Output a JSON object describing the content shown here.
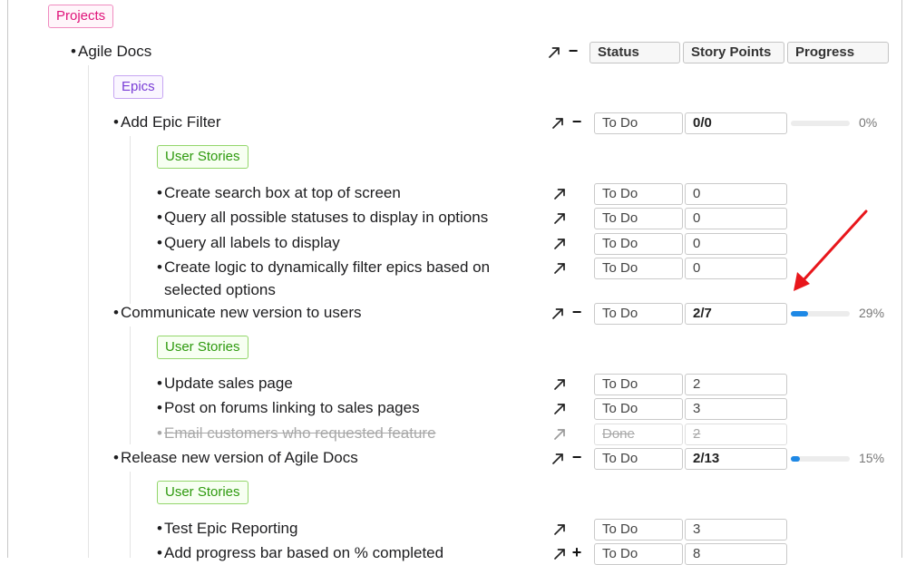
{
  "tags": {
    "projects": "Projects",
    "epics": "Epics",
    "user_stories": "User Stories"
  },
  "columns": {
    "status": "Status",
    "story_points": "Story Points",
    "progress": "Progress"
  },
  "icons": {
    "open": "arrow-up-left-icon",
    "collapse": "minus-icon",
    "expand": "plus-icon"
  },
  "colors": {
    "progress_fill": "#1e88e5",
    "projects_tag": "#e0137a",
    "epics_tag": "#7a3dd6",
    "stories_tag": "#2e9a0e",
    "annotation_arrow": "#e8161b"
  },
  "project": {
    "bullet": "•",
    "title": "Agile Docs",
    "control": "−"
  },
  "epics": [
    {
      "bullet": "•",
      "title": "Add Epic Filter",
      "control": "−",
      "status": "To Do",
      "points": "0/0",
      "progress": 0,
      "progress_label": "0%",
      "stories": [
        {
          "bullet": "•",
          "title": "Create search box at top of screen",
          "status": "To Do",
          "points": "0"
        },
        {
          "bullet": "•",
          "title": "Query all possible statuses to display in options",
          "status": "To Do",
          "points": "0"
        },
        {
          "bullet": "•",
          "title": "Query all labels to display",
          "status": "To Do",
          "points": "0"
        },
        {
          "bullet": "•",
          "title": "Create logic to dynamically filter epics based on",
          "title_cont": "selected options",
          "status": "To Do",
          "points": "0"
        }
      ]
    },
    {
      "bullet": "•",
      "title": "Communicate new version to users",
      "control": "−",
      "status": "To Do",
      "points": "2/7",
      "progress": 0.29,
      "progress_label": "29%",
      "stories": [
        {
          "bullet": "•",
          "title": "Update sales page",
          "status": "To Do",
          "points": "2"
        },
        {
          "bullet": "•",
          "title": "Post on forums linking to sales pages",
          "status": "To Do",
          "points": "3"
        },
        {
          "bullet": "•",
          "title": "Email customers who requested feature",
          "status": "Done",
          "points": "2"
        }
      ]
    },
    {
      "bullet": "•",
      "title": "Release new version of Agile Docs",
      "control": "−",
      "status": "To Do",
      "points": "2/13",
      "progress": 0.15,
      "progress_label": "15%",
      "stories": [
        {
          "bullet": "•",
          "title": "Test Epic Reporting",
          "status": "To Do",
          "points": "3"
        },
        {
          "bullet": "•",
          "title": "Add progress bar based on % completed",
          "control": "+",
          "status": "To Do",
          "points": "8"
        }
      ]
    }
  ]
}
